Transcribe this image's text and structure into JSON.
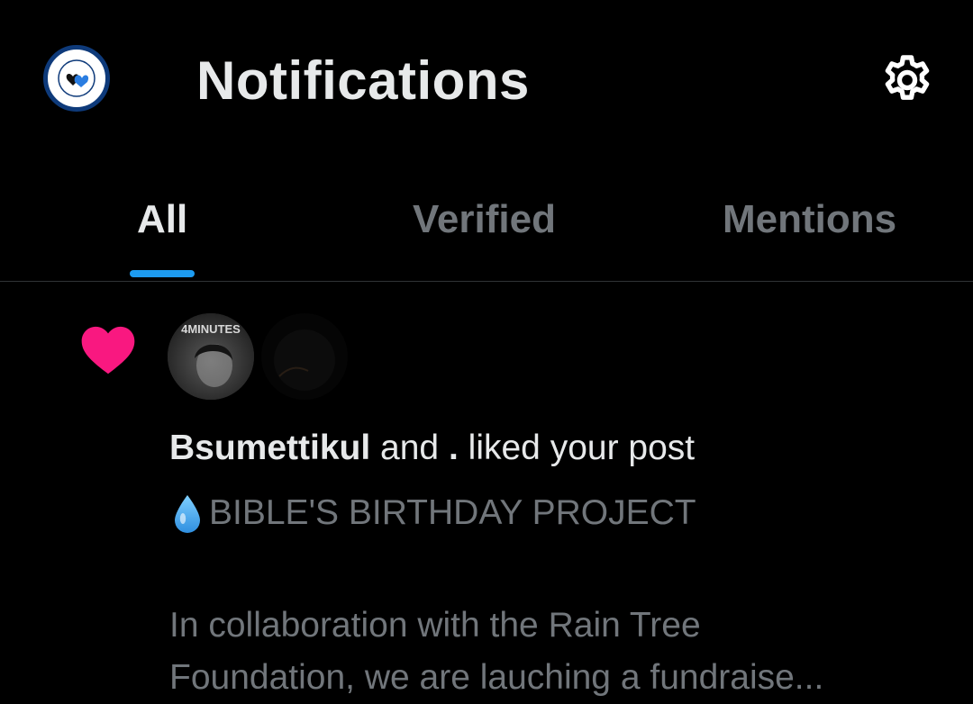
{
  "header": {
    "title": "Notifications",
    "avatar_icon": "bible-fanbase-logo-icon",
    "settings_icon": "gear-icon"
  },
  "tabs": [
    {
      "label": "All",
      "active": true
    },
    {
      "label": "Verified",
      "active": false
    },
    {
      "label": "Mentions",
      "active": false
    }
  ],
  "colors": {
    "accent": "#1d9bf0",
    "like": "#f91880",
    "text_primary": "#e7e9ea",
    "text_secondary": "#71767b",
    "background": "#000000"
  },
  "notification": {
    "type_icon": "heart-icon",
    "liker_name": "Bsumettikul",
    "conjunction": "and",
    "other_liker": ".",
    "action": "liked your post",
    "post_title_icon": "droplet-icon",
    "post_title": "BIBLE'S BIRTHDAY PROJECT",
    "post_body_line1": "In collaboration with the Rain Tree",
    "post_body_line2": "Foundation, we are lauching a fundraise...",
    "avatar1_caption": "4MINUTES"
  }
}
